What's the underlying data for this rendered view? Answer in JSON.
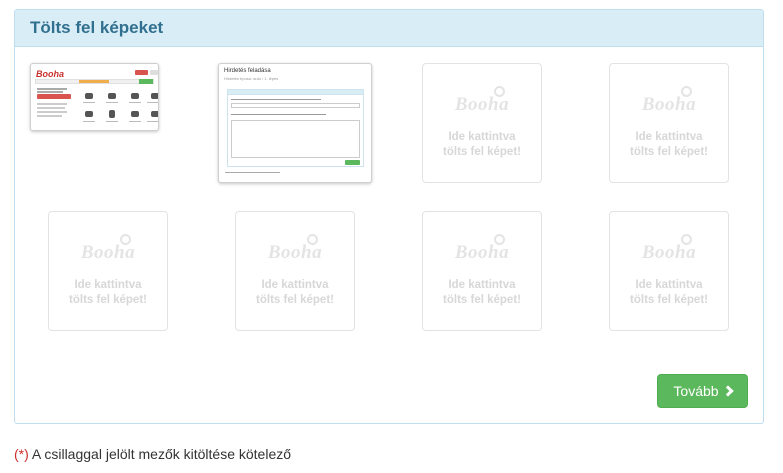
{
  "panel": {
    "title": "Tölts fel képeket"
  },
  "uploaded": [
    {
      "kind": "booha-homepage-screenshot",
      "logo_text": "Booha"
    },
    {
      "kind": "ad-form-screenshot",
      "title": "Hirdetés feladása",
      "subtitle": "Hirdetés típusa: autó / 1. lépés"
    }
  ],
  "placeholder": {
    "logo_text": "Booha",
    "line1": "Ide kattintva",
    "line2": "tölts fel képet!"
  },
  "actions": {
    "next_label": "Tovább",
    "next_icon": "chevron-right-icon"
  },
  "footer": {
    "required_marker": "(*)",
    "required_text": " A csillaggal jelölt mezők kitöltése kötelező"
  },
  "colors": {
    "header_bg": "#d9edf7",
    "title": "#31708f",
    "button": "#5cb85c",
    "required_star": "#c9302c"
  }
}
